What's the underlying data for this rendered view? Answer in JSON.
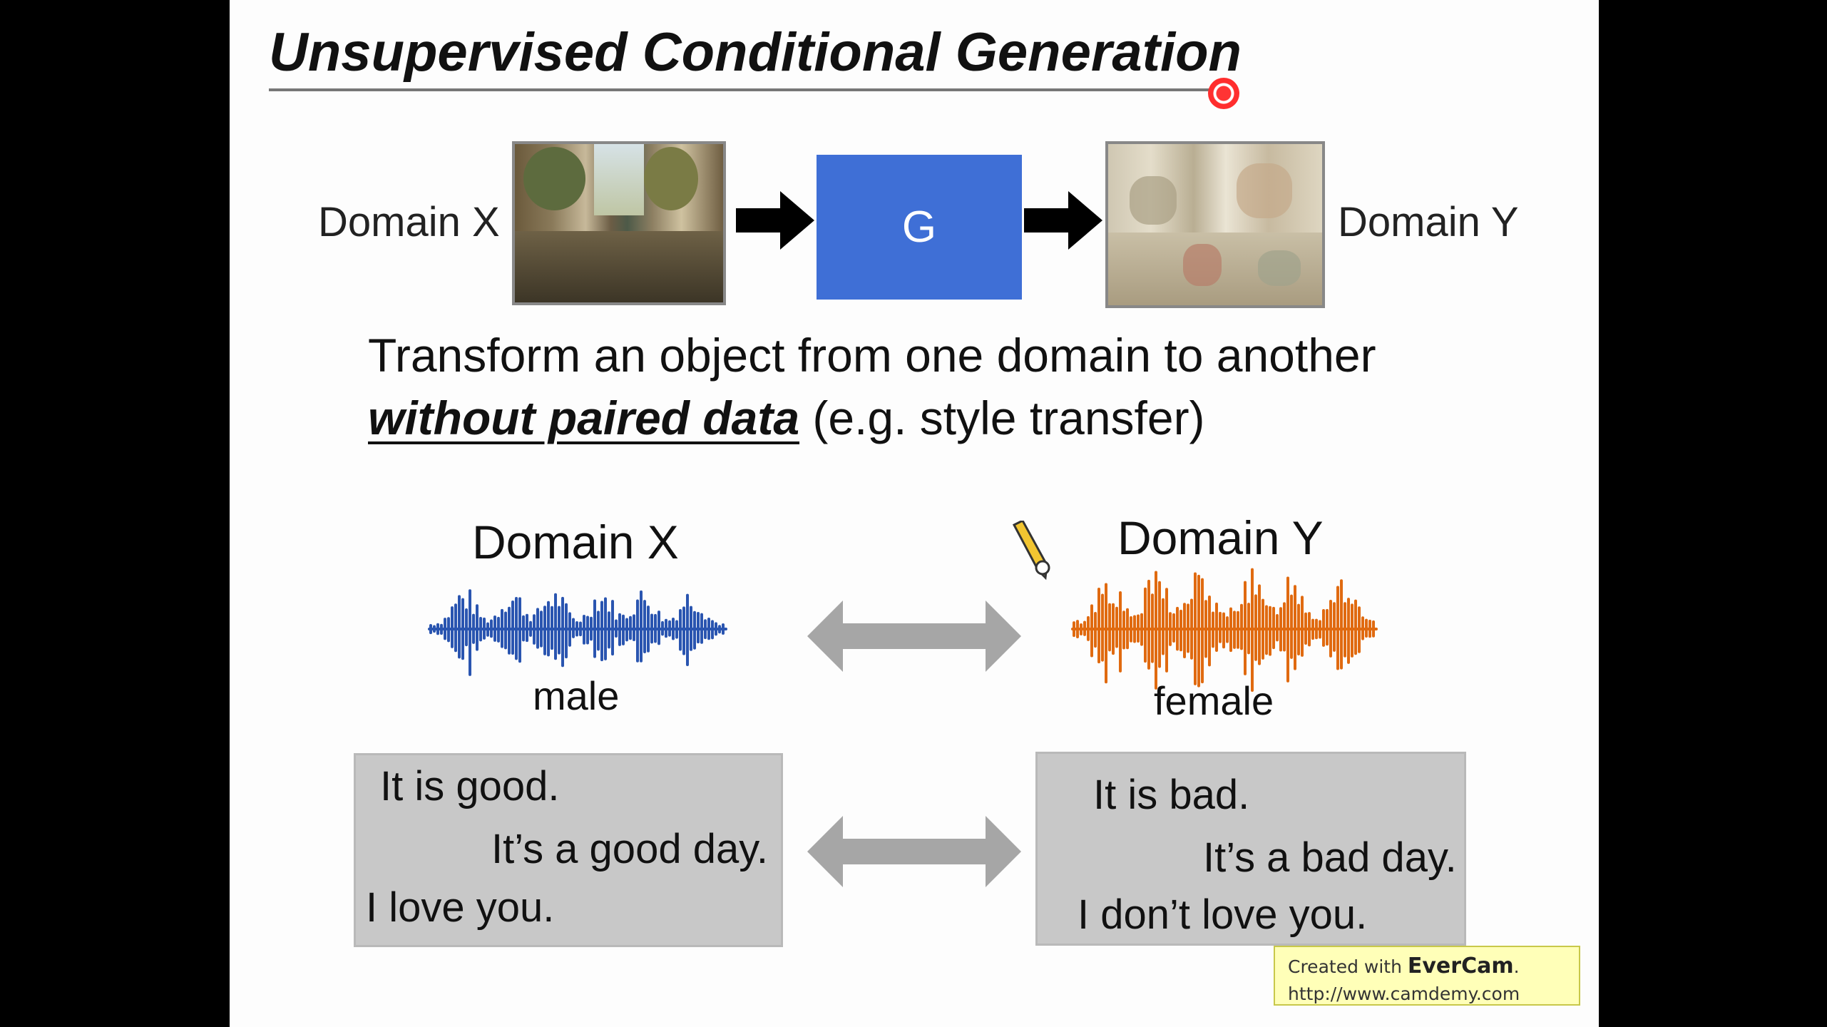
{
  "slide": {
    "title": "Unsupervised Conditional Generation",
    "top_row": {
      "left_label": "Domain X",
      "generator_label": "G",
      "right_label": "Domain Y"
    },
    "description": {
      "line1": "Transform an object from one domain to another",
      "line2_emphasis": "without paired data",
      "line2_rest": " (e.g. style transfer)"
    },
    "audio": {
      "left_header": "Domain X",
      "right_header": "Domain Y",
      "left_caption": "male",
      "right_caption": "female",
      "left_color": "#2a55b0",
      "right_color": "#e06a10"
    },
    "text_pairs": {
      "left": [
        "It is good.",
        "It’s a good day.",
        "I love you."
      ],
      "right": [
        "It is bad.",
        "It’s a bad day.",
        "I don’t love you."
      ]
    },
    "colors": {
      "generator_box": "#3f6fd6",
      "arrow_dark": "#000000",
      "arrow_gray": "#a6a6a6",
      "text_box": "#c8c8c8"
    }
  },
  "watermark": {
    "prefix": "Created with ",
    "brand": "EverCam",
    "suffix": ".",
    "url": "http://www.camdemy.com"
  },
  "icons": {
    "pointer": "laser-pointer-icon",
    "pencil": "pencil-icon"
  }
}
